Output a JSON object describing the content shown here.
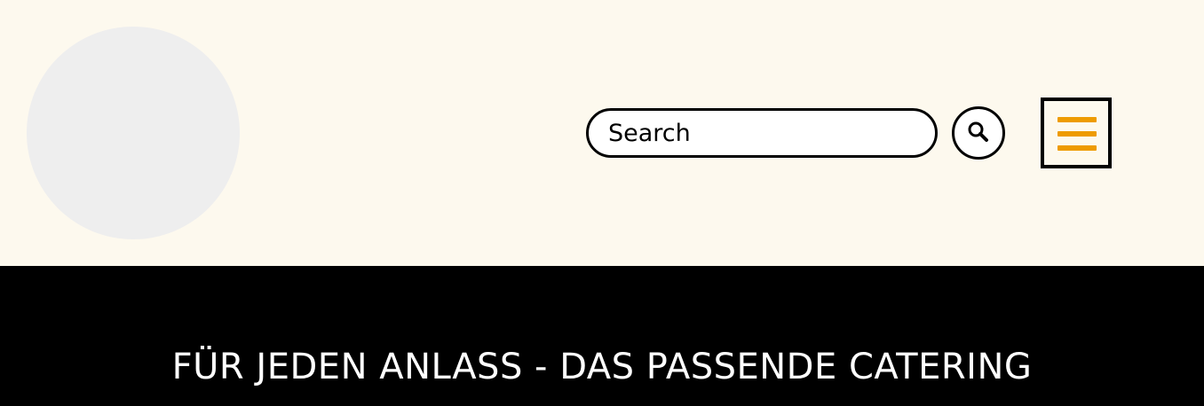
{
  "header": {
    "background_color": "#fdf9ee",
    "logo_placeholder_color": "#eeeeee",
    "search": {
      "placeholder": "Search",
      "value": "",
      "button_icon": "search-icon"
    },
    "menu": {
      "icon": "hamburger-menu-icon",
      "accent_color": "#ee9b00"
    }
  },
  "hero": {
    "background_color": "#000000",
    "tagline": "FÜR JEDEN ANLASS - DAS PASSENDE CATERING"
  }
}
